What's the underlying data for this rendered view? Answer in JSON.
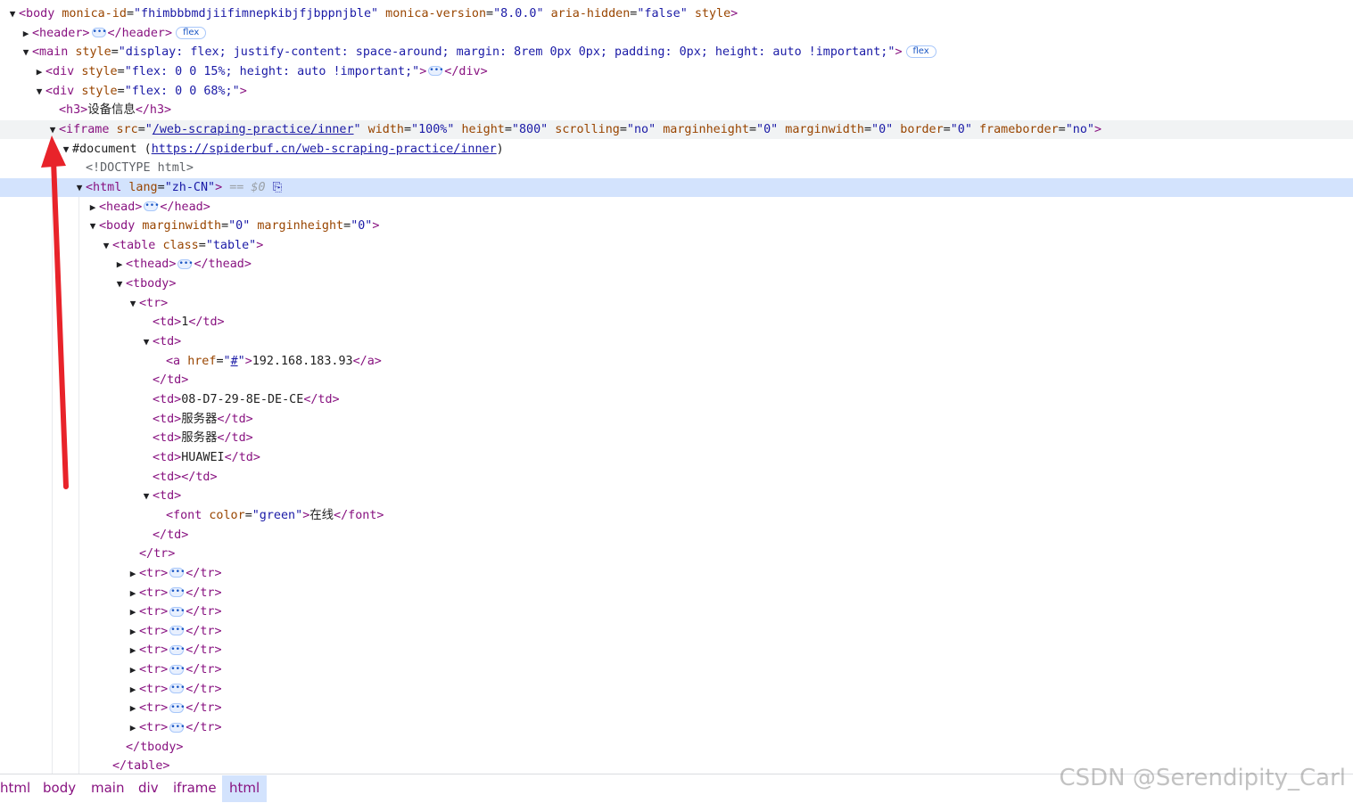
{
  "dom_tree": {
    "rows": [
      {
        "indent": 0,
        "arrow": "down",
        "html": "<span class=tg>&lt;body</span> <span class=an>monica-id</span>=<span class=av>\"fhimbbbmdjiifimnepkibjfjbppnjble\"</span> <span class=an>monica-version</span>=<span class=av>\"8.0.0\"</span> <span class=an>aria-hidden</span>=<span class=av>\"false\"</span> <span class=an>style</span><span class=tg>&gt;</span>"
      },
      {
        "indent": 1,
        "arrow": "right",
        "html": "<span class=tg>&lt;header&gt;</span><span class=ell>&bull;&bull;&bull;</span><span class=tg>&lt;/header&gt;</span><span class=badge>flex</span>"
      },
      {
        "indent": 1,
        "arrow": "down",
        "html": "<span class=tg>&lt;main</span> <span class=an>style</span>=<span class=av>\"display: flex; justify-content: space-around; margin: 8rem 0px 0px; padding: 0px; height: auto !important;\"</span><span class=tg>&gt;</span><span class=badge>flex</span>"
      },
      {
        "indent": 2,
        "arrow": "right",
        "html": "<span class=tg>&lt;div</span> <span class=an>style</span>=<span class=av>\"flex: 0 0 15%; height: auto !important;\"</span><span class=tg>&gt;</span><span class=ell>&bull;&bull;&bull;</span><span class=tg>&lt;/div&gt;</span>"
      },
      {
        "indent": 2,
        "arrow": "down",
        "html": "<span class=tg>&lt;div</span> <span class=an>style</span>=<span class=av>\"flex: 0 0 68%;\"</span><span class=tg>&gt;</span>"
      },
      {
        "indent": 3,
        "arrow": "",
        "html": "<span class=tg>&lt;h3&gt;</span><span class=tx>设备信息</span><span class=tg>&lt;/h3&gt;</span>"
      },
      {
        "indent": 3,
        "arrow": "down",
        "hover": true,
        "html": "<span class=tg>&lt;iframe</span> <span class=an>src</span>=<span class=av>\"</span><span class=lk>/web-scraping-practice/inner</span><span class=av>\"</span> <span class=an>width</span>=<span class=av>\"100%\"</span> <span class=an>height</span>=<span class=av>\"800\"</span> <span class=an>scrolling</span>=<span class=av>\"no\"</span> <span class=an>marginheight</span>=<span class=av>\"0\"</span> <span class=an>marginwidth</span>=<span class=av>\"0\"</span> <span class=an>border</span>=<span class=av>\"0\"</span> <span class=an>frameborder</span>=<span class=av>\"no\"</span><span class=tg>&gt;</span>"
      },
      {
        "indent": 4,
        "arrow": "down",
        "html": "<span class=tx>#document (</span><span class=lk>https://spiderbuf.cn/web-scraping-practice/inner</span><span class=tx>)</span>"
      },
      {
        "indent": 5,
        "arrow": "",
        "html": "<span class=dc>&lt;!DOCTYPE html&gt;</span>"
      },
      {
        "indent": 5,
        "arrow": "down",
        "selected": true,
        "html": "<span class=tg>&lt;html</span> <span class=an>lang</span>=<span class=av>\"zh-CN\"</span><span class=tg>&gt;</span> <span class=eq>== $0</span> <span class=av>&#x2398;</span>"
      },
      {
        "indent": 6,
        "arrow": "right",
        "html": "<span class=tg>&lt;head&gt;</span><span class=ell>&bull;&bull;&bull;</span><span class=tg>&lt;/head&gt;</span>"
      },
      {
        "indent": 6,
        "arrow": "down",
        "html": "<span class=tg>&lt;body</span> <span class=an>marginwidth</span>=<span class=av>\"0\"</span> <span class=an>marginheight</span>=<span class=av>\"0\"</span><span class=tg>&gt;</span>"
      },
      {
        "indent": 7,
        "arrow": "down",
        "html": "<span class=tg>&lt;table</span> <span class=an>class</span>=<span class=av>\"table\"</span><span class=tg>&gt;</span>"
      },
      {
        "indent": 8,
        "arrow": "right",
        "html": "<span class=tg>&lt;thead&gt;</span><span class=ell>&bull;&bull;&bull;</span><span class=tg>&lt;/thead&gt;</span>"
      },
      {
        "indent": 8,
        "arrow": "down",
        "html": "<span class=tg>&lt;tbody&gt;</span>"
      },
      {
        "indent": 9,
        "arrow": "down",
        "html": "<span class=tg>&lt;tr&gt;</span>"
      },
      {
        "indent": 10,
        "arrow": "",
        "html": "<span class=tg>&lt;td&gt;</span><span class=tx>1</span><span class=tg>&lt;/td&gt;</span>"
      },
      {
        "indent": 10,
        "arrow": "down",
        "html": "<span class=tg>&lt;td&gt;</span>"
      },
      {
        "indent": 11,
        "arrow": "",
        "html": "<span class=tg>&lt;a</span> <span class=an>href</span>=<span class=av>\"</span><span class=lk>#</span><span class=av>\"</span><span class=tg>&gt;</span><span class=tx>192.168.183.93</span><span class=tg>&lt;/a&gt;</span>"
      },
      {
        "indent": 10,
        "arrow": "",
        "html": "<span class=tg>&lt;/td&gt;</span>"
      },
      {
        "indent": 10,
        "arrow": "",
        "html": "<span class=tg>&lt;td&gt;</span><span class=tx>08-D7-29-8E-DE-CE</span><span class=tg>&lt;/td&gt;</span>"
      },
      {
        "indent": 10,
        "arrow": "",
        "html": "<span class=tg>&lt;td&gt;</span><span class=tx>服务器</span><span class=tg>&lt;/td&gt;</span>"
      },
      {
        "indent": 10,
        "arrow": "",
        "html": "<span class=tg>&lt;td&gt;</span><span class=tx>服务器</span><span class=tg>&lt;/td&gt;</span>"
      },
      {
        "indent": 10,
        "arrow": "",
        "html": "<span class=tg>&lt;td&gt;</span><span class=tx>HUAWEI</span><span class=tg>&lt;/td&gt;</span>"
      },
      {
        "indent": 10,
        "arrow": "",
        "html": "<span class=tg>&lt;td&gt;&lt;/td&gt;</span>"
      },
      {
        "indent": 10,
        "arrow": "down",
        "html": "<span class=tg>&lt;td&gt;</span>"
      },
      {
        "indent": 11,
        "arrow": "",
        "html": "<span class=tg>&lt;font</span> <span class=an>color</span>=<span class=av>\"green\"</span><span class=tg>&gt;</span><span class=tx>在线</span><span class=tg>&lt;/font&gt;</span>"
      },
      {
        "indent": 10,
        "arrow": "",
        "html": "<span class=tg>&lt;/td&gt;</span>"
      },
      {
        "indent": 9,
        "arrow": "",
        "html": "<span class=tg>&lt;/tr&gt;</span>"
      },
      {
        "indent": 9,
        "arrow": "right",
        "html": "<span class=tg>&lt;tr&gt;</span><span class=ell>&bull;&bull;&bull;</span><span class=tg>&lt;/tr&gt;</span>"
      },
      {
        "indent": 9,
        "arrow": "right",
        "html": "<span class=tg>&lt;tr&gt;</span><span class=ell>&bull;&bull;&bull;</span><span class=tg>&lt;/tr&gt;</span>"
      },
      {
        "indent": 9,
        "arrow": "right",
        "html": "<span class=tg>&lt;tr&gt;</span><span class=ell>&bull;&bull;&bull;</span><span class=tg>&lt;/tr&gt;</span>"
      },
      {
        "indent": 9,
        "arrow": "right",
        "html": "<span class=tg>&lt;tr&gt;</span><span class=ell>&bull;&bull;&bull;</span><span class=tg>&lt;/tr&gt;</span>"
      },
      {
        "indent": 9,
        "arrow": "right",
        "html": "<span class=tg>&lt;tr&gt;</span><span class=ell>&bull;&bull;&bull;</span><span class=tg>&lt;/tr&gt;</span>"
      },
      {
        "indent": 9,
        "arrow": "right",
        "html": "<span class=tg>&lt;tr&gt;</span><span class=ell>&bull;&bull;&bull;</span><span class=tg>&lt;/tr&gt;</span>"
      },
      {
        "indent": 9,
        "arrow": "right",
        "html": "<span class=tg>&lt;tr&gt;</span><span class=ell>&bull;&bull;&bull;</span><span class=tg>&lt;/tr&gt;</span>"
      },
      {
        "indent": 9,
        "arrow": "right",
        "html": "<span class=tg>&lt;tr&gt;</span><span class=ell>&bull;&bull;&bull;</span><span class=tg>&lt;/tr&gt;</span>"
      },
      {
        "indent": 9,
        "arrow": "right",
        "html": "<span class=tg>&lt;tr&gt;</span><span class=ell>&bull;&bull;&bull;</span><span class=tg>&lt;/tr&gt;</span>"
      },
      {
        "indent": 8,
        "arrow": "",
        "html": "<span class=tg>&lt;/tbody&gt;</span>"
      },
      {
        "indent": 7,
        "arrow": "",
        "html": "<span class=tg>&lt;/table&gt;</span>"
      }
    ]
  },
  "breadcrumbs": {
    "items": [
      "html",
      "body",
      "main",
      "div",
      "iframe",
      "html"
    ],
    "active_index": 5
  },
  "annotation": {
    "arrow_color": "#e8232a"
  },
  "watermark": {
    "text": "CSDN @Serendipity_Carl"
  },
  "colors": {
    "tag": "#881280",
    "attr_name": "#994500",
    "attr_value": "#1a1aa6",
    "selected_row": "#d3e3fd"
  }
}
